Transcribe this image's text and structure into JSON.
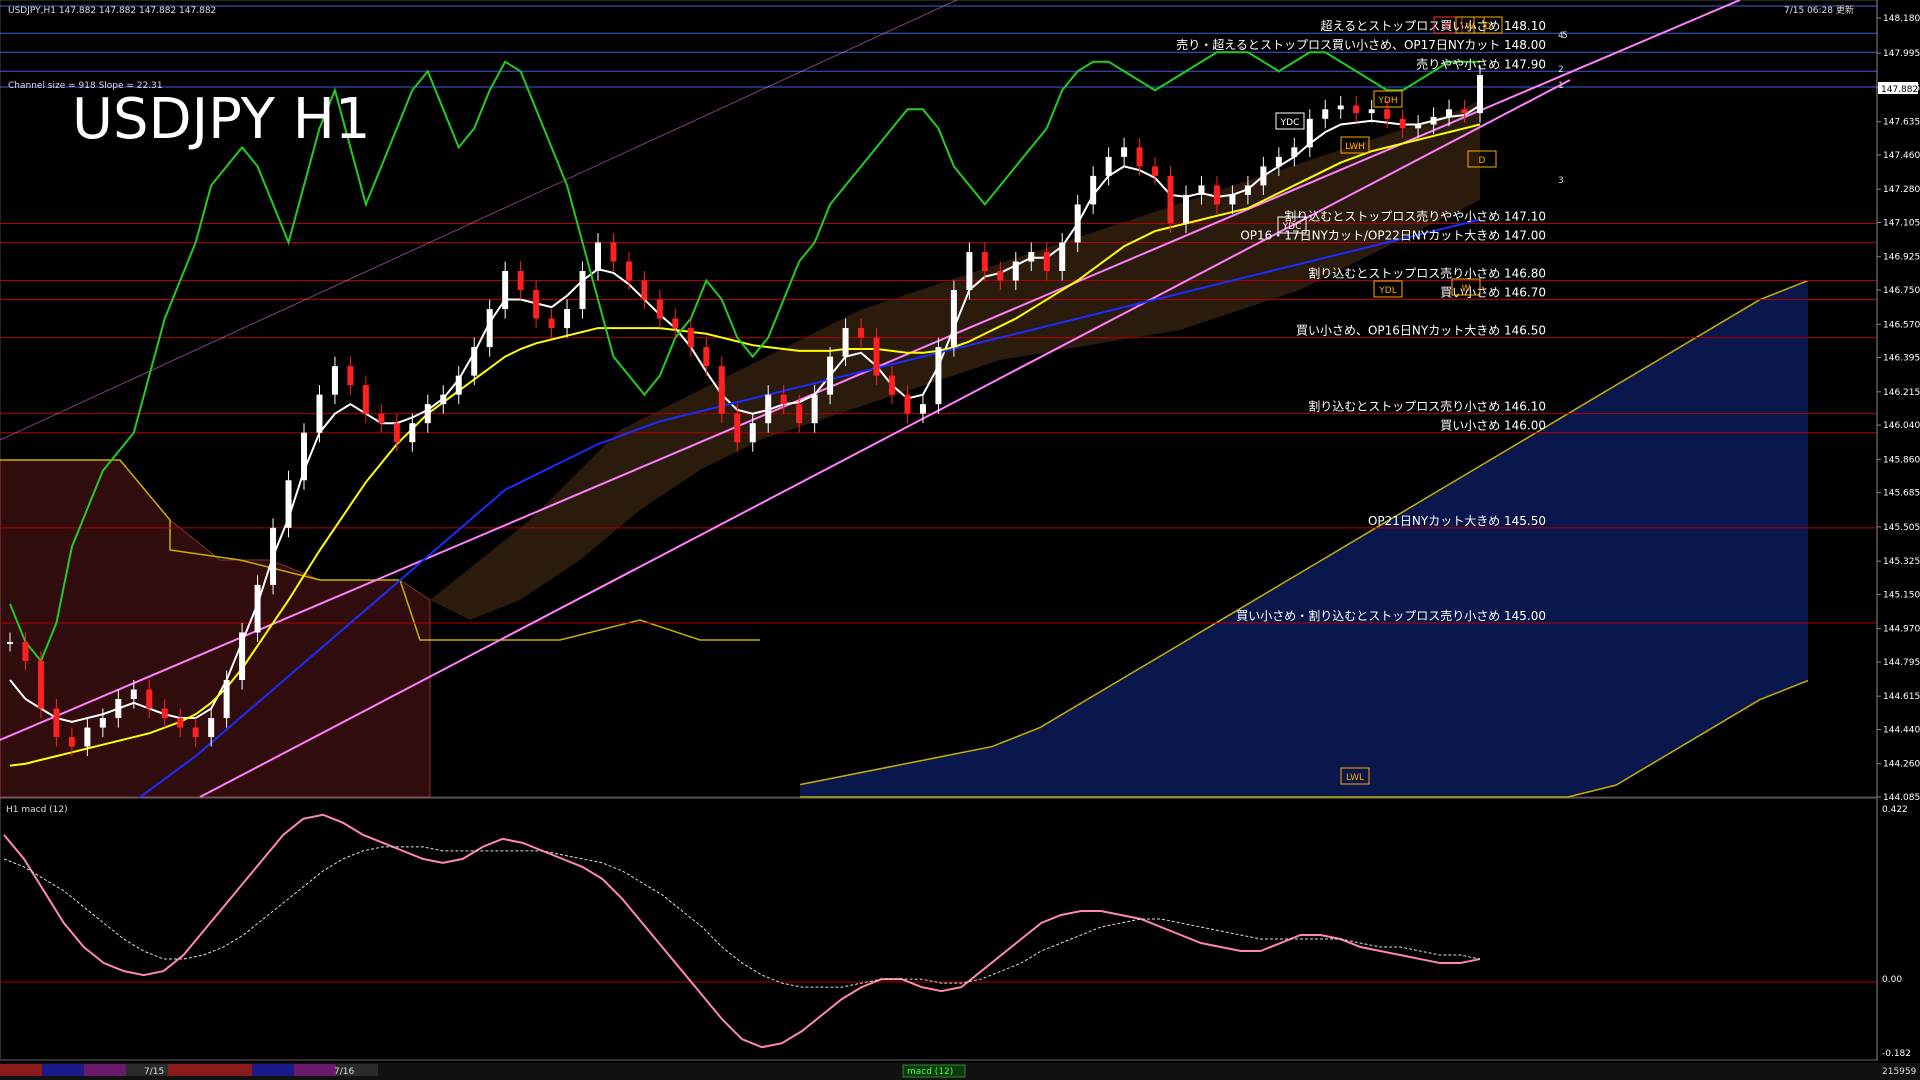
{
  "header": {
    "symbol_line": "USDJPY,H1  147.882 147.882 147.882 147.882",
    "timestamp": "7/15 06:28 更新",
    "channel_info": "Channel size = 918 Slope = 22.31",
    "chart_title": "USDJPY H1",
    "sub_title": "H1  macd (12)"
  },
  "chart_data": [
    {
      "type": "line",
      "panel": "price",
      "title": "USDJPY H1",
      "ylim": [
        144.085,
        148.18
      ],
      "y_ticks": [
        "148.180",
        "147.995",
        "147.815",
        "147.635",
        "147.460",
        "147.280",
        "147.105",
        "146.925",
        "146.750",
        "146.570",
        "146.395",
        "146.215",
        "146.040",
        "145.860",
        "145.685",
        "145.505",
        "145.325",
        "145.150",
        "144.970",
        "144.795",
        "144.615",
        "144.440",
        "144.260",
        "144.085"
      ],
      "current_price": "147.882",
      "levels": [
        {
          "price": 148.1,
          "label": "超えるとストップロス買い小さめ 148.10"
        },
        {
          "price": 148.0,
          "label": "売り・超えるとストップロス買い小さめ、OP17日NYカット 148.00"
        },
        {
          "price": 147.9,
          "label": "売りやや小さめ 147.90"
        },
        {
          "price": 147.1,
          "label": "割り込むとストップロス売りやや小さめ 147.10"
        },
        {
          "price": 147.0,
          "label": "OP16・17日NYカット/OP22日NYカット大きめ 147.00"
        },
        {
          "price": 146.8,
          "label": "割り込むとストップロス売り小さめ 146.80"
        },
        {
          "price": 146.7,
          "label": "買い小さめ 146.70"
        },
        {
          "price": 146.5,
          "label": "買い小さめ、OP16日NYカット大きめ 146.50"
        },
        {
          "price": 146.1,
          "label": "割り込むとストップロス売り小さめ 146.10"
        },
        {
          "price": 146.0,
          "label": "買い小さめ 146.00"
        },
        {
          "price": 145.5,
          "label": "OP21日NYカット大きめ 145.50"
        },
        {
          "price": 145.0,
          "label": "買い小さめ・割り込むとストップロス売り小さめ 145.00"
        }
      ],
      "markers": [
        "YDC",
        "YDH",
        "LWH",
        "YDC",
        "YDL",
        "LWL",
        "M",
        "W",
        "D",
        "W",
        "D"
      ],
      "channel_labels": [
        "1",
        "2",
        "3",
        "4",
        "5"
      ],
      "price_series": [
        144.9,
        144.8,
        144.55,
        144.4,
        144.35,
        144.45,
        144.5,
        144.6,
        144.65,
        144.55,
        144.5,
        144.45,
        144.4,
        144.5,
        144.7,
        144.95,
        145.2,
        145.5,
        145.75,
        146.0,
        146.2,
        146.35,
        146.25,
        146.1,
        146.05,
        145.95,
        146.05,
        146.15,
        146.2,
        146.3,
        146.45,
        146.65,
        146.85,
        146.75,
        146.6,
        146.55,
        146.65,
        146.85,
        147.0,
        146.9,
        146.8,
        146.7,
        146.6,
        146.55,
        146.45,
        146.35,
        146.1,
        145.95,
        146.05,
        146.2,
        146.15,
        146.05,
        146.2,
        146.4,
        146.55,
        146.5,
        146.3,
        146.2,
        146.1,
        146.15,
        146.45,
        146.75,
        146.95,
        146.85,
        146.8,
        146.9,
        146.95,
        146.85,
        147.0,
        147.2,
        147.35,
        147.45,
        147.5,
        147.4,
        147.35,
        147.1,
        147.25,
        147.3,
        147.2,
        147.25,
        147.3,
        147.4,
        147.45,
        147.5,
        147.65,
        147.7,
        147.72,
        147.68,
        147.7,
        147.65,
        147.6,
        147.62,
        147.66,
        147.7,
        147.68,
        147.88
      ],
      "series": [
        {
          "name": "",
          "color": "#ffffff",
          "values": [
            144.7,
            144.6,
            144.55,
            144.5,
            144.48,
            144.5,
            144.52,
            144.55,
            144.58,
            144.55,
            144.52,
            144.5,
            144.5,
            144.55,
            144.7,
            144.9,
            145.1,
            145.35,
            145.55,
            145.8,
            146.0,
            146.1,
            146.15,
            146.1,
            146.05,
            146.05,
            146.08,
            146.12,
            146.18,
            146.28,
            146.42,
            146.58,
            146.7,
            146.7,
            146.68,
            146.66,
            146.72,
            146.8,
            146.86,
            146.84,
            146.78,
            146.7,
            146.62,
            146.55,
            146.45,
            146.32,
            146.2,
            146.12,
            146.1,
            146.12,
            146.15,
            146.16,
            146.2,
            146.3,
            146.4,
            146.42,
            146.35,
            146.25,
            146.18,
            146.2,
            146.35,
            146.55,
            146.75,
            146.82,
            146.84,
            146.88,
            146.92,
            146.92,
            146.98,
            147.1,
            147.25,
            147.35,
            147.4,
            147.38,
            147.34,
            147.25,
            147.24,
            147.26,
            147.24,
            147.25,
            147.28,
            147.35,
            147.4,
            147.45,
            147.52,
            147.58,
            147.62,
            147.63,
            147.64,
            147.63,
            147.62,
            147.62,
            147.64,
            147.66,
            147.67,
            147.72
          ]
        },
        {
          "name": "",
          "color": "#ffff00",
          "values": [
            144.25,
            144.26,
            144.28,
            144.3,
            144.32,
            144.34,
            144.36,
            144.38,
            144.4,
            144.42,
            144.45,
            144.48,
            144.52,
            144.58,
            144.66,
            144.76,
            144.88,
            145.0,
            145.12,
            145.25,
            145.38,
            145.5,
            145.62,
            145.74,
            145.84,
            145.94,
            146.02,
            146.1,
            146.16,
            146.22,
            146.28,
            146.34,
            146.4,
            146.44,
            146.47,
            146.49,
            146.51,
            146.53,
            146.55,
            146.55,
            146.55,
            146.55,
            146.55,
            146.54,
            146.53,
            146.52,
            146.5,
            146.48,
            146.46,
            146.45,
            146.44,
            146.43,
            146.43,
            146.43,
            146.44,
            146.44,
            146.44,
            146.43,
            146.42,
            146.42,
            146.43,
            146.45,
            146.48,
            146.52,
            146.56,
            146.6,
            146.65,
            146.7,
            146.75,
            146.8,
            146.86,
            146.92,
            146.98,
            147.02,
            147.06,
            147.08,
            147.1,
            147.12,
            147.14,
            147.16,
            147.18,
            147.22,
            147.26,
            147.3,
            147.34,
            147.38,
            147.42,
            147.45,
            147.48,
            147.5,
            147.52,
            147.54,
            147.56,
            147.58,
            147.6,
            147.62
          ]
        },
        {
          "name": "",
          "color": "#1a2cff",
          "values": [
            143.6,
            143.65,
            143.7,
            143.76,
            143.82,
            143.88,
            143.94,
            144.0,
            144.06,
            144.12,
            144.18,
            144.24,
            144.3,
            144.37,
            144.44,
            144.51,
            144.58,
            144.65,
            144.72,
            144.79,
            144.86,
            144.93,
            145.0,
            145.07,
            145.14,
            145.21,
            145.28,
            145.35,
            145.42,
            145.49,
            145.56,
            145.63,
            145.7,
            145.74,
            145.78,
            145.82,
            145.86,
            145.9,
            145.94,
            145.97,
            146.0,
            146.03,
            146.06,
            146.08,
            146.1,
            146.12,
            146.14,
            146.16,
            146.18,
            146.2,
            146.22,
            146.24,
            146.26,
            146.28,
            146.3,
            146.32,
            146.34,
            146.36,
            146.38,
            146.4,
            146.42,
            146.44,
            146.46,
            146.48,
            146.5,
            146.52,
            146.54,
            146.56,
            146.58,
            146.6,
            146.62,
            146.64,
            146.66,
            146.68,
            146.7,
            146.72,
            146.74,
            146.76,
            146.78,
            146.8,
            146.82,
            146.84,
            146.86,
            146.88,
            146.9,
            146.92,
            146.94,
            146.96,
            146.98,
            147.0,
            147.02,
            147.04,
            147.06,
            147.08,
            147.1,
            147.12
          ]
        },
        {
          "name": "",
          "color": "#22cc22",
          "values": [
            145.1,
            144.9,
            144.8,
            145.0,
            145.4,
            145.6,
            145.8,
            145.9,
            146.0,
            146.3,
            146.6,
            146.8,
            147.0,
            147.3,
            147.4,
            147.5,
            147.4,
            147.2,
            147.0,
            147.3,
            147.6,
            147.8,
            147.5,
            147.2,
            147.4,
            147.6,
            147.8,
            147.9,
            147.7,
            147.5,
            147.6,
            147.8,
            147.95,
            147.9,
            147.7,
            147.5,
            147.3,
            147.0,
            146.7,
            146.4,
            146.3,
            146.2,
            146.3,
            146.5,
            146.6,
            146.8,
            146.7,
            146.5,
            146.4,
            146.5,
            146.7,
            146.9,
            147.0,
            147.2,
            147.3,
            147.4,
            147.5,
            147.6,
            147.7,
            147.7,
            147.6,
            147.4,
            147.3,
            147.2,
            147.3,
            147.4,
            147.5,
            147.6,
            147.8,
            147.9,
            147.95,
            147.95,
            147.9,
            147.85,
            147.8,
            147.85,
            147.9,
            147.95,
            148.0,
            148.0,
            148.0,
            147.95,
            147.9,
            147.95,
            148.0,
            148.0,
            147.95,
            147.9,
            147.85,
            147.8,
            147.8,
            147.85,
            147.9,
            147.95,
            147.95,
            147.95
          ]
        }
      ],
      "cloud_projection": [
        144.15,
        144.2,
        144.25,
        144.3,
        144.35,
        144.45,
        144.6,
        144.75,
        144.9,
        145.05,
        145.2,
        145.35,
        145.5,
        145.65,
        145.8,
        145.95,
        146.1,
        146.25,
        146.4,
        146.55,
        146.7,
        146.8
      ]
    },
    {
      "type": "line",
      "panel": "macd",
      "title": "H1  macd (12)",
      "ylim": [
        -0.182,
        0.422
      ],
      "y_ticks": [
        "0.422",
        "0.00",
        "-0.182"
      ],
      "series": [
        {
          "name": "",
          "color": "#ff88aa",
          "values": [
            0.36,
            0.3,
            0.22,
            0.14,
            0.08,
            0.04,
            0.02,
            0.01,
            0.02,
            0.06,
            0.12,
            0.18,
            0.24,
            0.3,
            0.36,
            0.4,
            0.41,
            0.39,
            0.36,
            0.34,
            0.32,
            0.3,
            0.29,
            0.3,
            0.33,
            0.35,
            0.34,
            0.32,
            0.3,
            0.28,
            0.25,
            0.2,
            0.14,
            0.08,
            0.02,
            -0.04,
            -0.1,
            -0.15,
            -0.17,
            -0.16,
            -0.13,
            -0.09,
            -0.05,
            -0.02,
            0.0,
            0.0,
            -0.02,
            -0.03,
            -0.02,
            0.02,
            0.06,
            0.1,
            0.14,
            0.16,
            0.17,
            0.17,
            0.16,
            0.15,
            0.13,
            0.11,
            0.09,
            0.08,
            0.07,
            0.07,
            0.09,
            0.11,
            0.11,
            0.1,
            0.08,
            0.07,
            0.06,
            0.05,
            0.04,
            0.04,
            0.05
          ]
        },
        {
          "name": "",
          "color": "#dddddd",
          "values": [
            0.3,
            0.28,
            0.25,
            0.22,
            0.18,
            0.14,
            0.1,
            0.07,
            0.05,
            0.05,
            0.06,
            0.08,
            0.11,
            0.15,
            0.19,
            0.23,
            0.27,
            0.3,
            0.32,
            0.33,
            0.33,
            0.33,
            0.32,
            0.32,
            0.32,
            0.32,
            0.32,
            0.32,
            0.31,
            0.3,
            0.29,
            0.27,
            0.24,
            0.21,
            0.17,
            0.13,
            0.08,
            0.04,
            0.01,
            -0.01,
            -0.02,
            -0.02,
            -0.02,
            -0.01,
            0.0,
            0.0,
            0.0,
            -0.01,
            -0.01,
            0.0,
            0.02,
            0.04,
            0.07,
            0.09,
            0.11,
            0.13,
            0.14,
            0.15,
            0.15,
            0.14,
            0.13,
            0.12,
            0.11,
            0.1,
            0.1,
            0.1,
            0.1,
            0.1,
            0.09,
            0.08,
            0.08,
            0.07,
            0.06,
            0.06,
            0.05
          ]
        }
      ]
    }
  ],
  "bottom_bar": {
    "dates": [
      "7/15",
      "7/16"
    ],
    "indicator_tag": "macd (12)",
    "right_value": "215959"
  }
}
